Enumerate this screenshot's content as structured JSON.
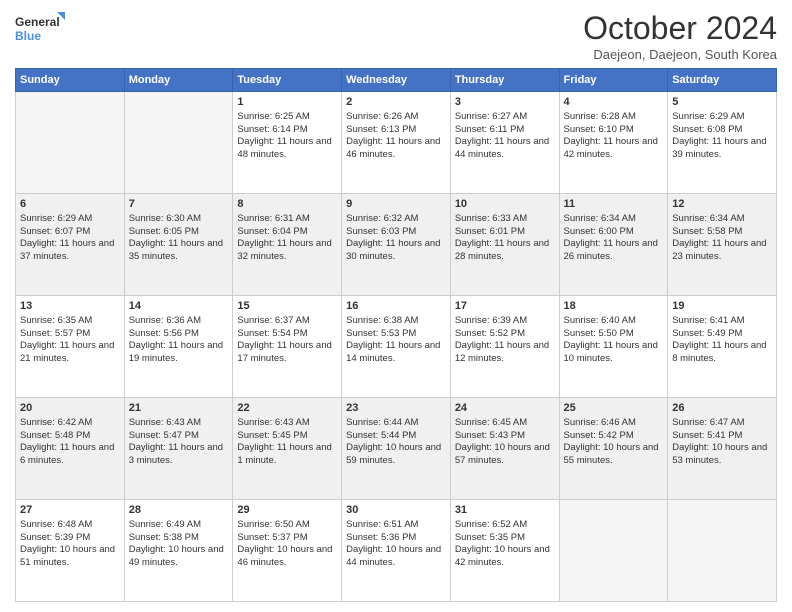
{
  "logo": {
    "line1": "General",
    "line2": "Blue"
  },
  "header": {
    "title": "October 2024",
    "location": "Daejeon, Daejeon, South Korea"
  },
  "weekdays": [
    "Sunday",
    "Monday",
    "Tuesday",
    "Wednesday",
    "Thursday",
    "Friday",
    "Saturday"
  ],
  "weeks": [
    [
      {
        "day": "",
        "info": ""
      },
      {
        "day": "",
        "info": ""
      },
      {
        "day": "1",
        "info": "Sunrise: 6:25 AM\nSunset: 6:14 PM\nDaylight: 11 hours and 48 minutes."
      },
      {
        "day": "2",
        "info": "Sunrise: 6:26 AM\nSunset: 6:13 PM\nDaylight: 11 hours and 46 minutes."
      },
      {
        "day": "3",
        "info": "Sunrise: 6:27 AM\nSunset: 6:11 PM\nDaylight: 11 hours and 44 minutes."
      },
      {
        "day": "4",
        "info": "Sunrise: 6:28 AM\nSunset: 6:10 PM\nDaylight: 11 hours and 42 minutes."
      },
      {
        "day": "5",
        "info": "Sunrise: 6:29 AM\nSunset: 6:08 PM\nDaylight: 11 hours and 39 minutes."
      }
    ],
    [
      {
        "day": "6",
        "info": "Sunrise: 6:29 AM\nSunset: 6:07 PM\nDaylight: 11 hours and 37 minutes."
      },
      {
        "day": "7",
        "info": "Sunrise: 6:30 AM\nSunset: 6:05 PM\nDaylight: 11 hours and 35 minutes."
      },
      {
        "day": "8",
        "info": "Sunrise: 6:31 AM\nSunset: 6:04 PM\nDaylight: 11 hours and 32 minutes."
      },
      {
        "day": "9",
        "info": "Sunrise: 6:32 AM\nSunset: 6:03 PM\nDaylight: 11 hours and 30 minutes."
      },
      {
        "day": "10",
        "info": "Sunrise: 6:33 AM\nSunset: 6:01 PM\nDaylight: 11 hours and 28 minutes."
      },
      {
        "day": "11",
        "info": "Sunrise: 6:34 AM\nSunset: 6:00 PM\nDaylight: 11 hours and 26 minutes."
      },
      {
        "day": "12",
        "info": "Sunrise: 6:34 AM\nSunset: 5:58 PM\nDaylight: 11 hours and 23 minutes."
      }
    ],
    [
      {
        "day": "13",
        "info": "Sunrise: 6:35 AM\nSunset: 5:57 PM\nDaylight: 11 hours and 21 minutes."
      },
      {
        "day": "14",
        "info": "Sunrise: 6:36 AM\nSunset: 5:56 PM\nDaylight: 11 hours and 19 minutes."
      },
      {
        "day": "15",
        "info": "Sunrise: 6:37 AM\nSunset: 5:54 PM\nDaylight: 11 hours and 17 minutes."
      },
      {
        "day": "16",
        "info": "Sunrise: 6:38 AM\nSunset: 5:53 PM\nDaylight: 11 hours and 14 minutes."
      },
      {
        "day": "17",
        "info": "Sunrise: 6:39 AM\nSunset: 5:52 PM\nDaylight: 11 hours and 12 minutes."
      },
      {
        "day": "18",
        "info": "Sunrise: 6:40 AM\nSunset: 5:50 PM\nDaylight: 11 hours and 10 minutes."
      },
      {
        "day": "19",
        "info": "Sunrise: 6:41 AM\nSunset: 5:49 PM\nDaylight: 11 hours and 8 minutes."
      }
    ],
    [
      {
        "day": "20",
        "info": "Sunrise: 6:42 AM\nSunset: 5:48 PM\nDaylight: 11 hours and 6 minutes."
      },
      {
        "day": "21",
        "info": "Sunrise: 6:43 AM\nSunset: 5:47 PM\nDaylight: 11 hours and 3 minutes."
      },
      {
        "day": "22",
        "info": "Sunrise: 6:43 AM\nSunset: 5:45 PM\nDaylight: 11 hours and 1 minute."
      },
      {
        "day": "23",
        "info": "Sunrise: 6:44 AM\nSunset: 5:44 PM\nDaylight: 10 hours and 59 minutes."
      },
      {
        "day": "24",
        "info": "Sunrise: 6:45 AM\nSunset: 5:43 PM\nDaylight: 10 hours and 57 minutes."
      },
      {
        "day": "25",
        "info": "Sunrise: 6:46 AM\nSunset: 5:42 PM\nDaylight: 10 hours and 55 minutes."
      },
      {
        "day": "26",
        "info": "Sunrise: 6:47 AM\nSunset: 5:41 PM\nDaylight: 10 hours and 53 minutes."
      }
    ],
    [
      {
        "day": "27",
        "info": "Sunrise: 6:48 AM\nSunset: 5:39 PM\nDaylight: 10 hours and 51 minutes."
      },
      {
        "day": "28",
        "info": "Sunrise: 6:49 AM\nSunset: 5:38 PM\nDaylight: 10 hours and 49 minutes."
      },
      {
        "day": "29",
        "info": "Sunrise: 6:50 AM\nSunset: 5:37 PM\nDaylight: 10 hours and 46 minutes."
      },
      {
        "day": "30",
        "info": "Sunrise: 6:51 AM\nSunset: 5:36 PM\nDaylight: 10 hours and 44 minutes."
      },
      {
        "day": "31",
        "info": "Sunrise: 6:52 AM\nSunset: 5:35 PM\nDaylight: 10 hours and 42 minutes."
      },
      {
        "day": "",
        "info": ""
      },
      {
        "day": "",
        "info": ""
      }
    ]
  ]
}
